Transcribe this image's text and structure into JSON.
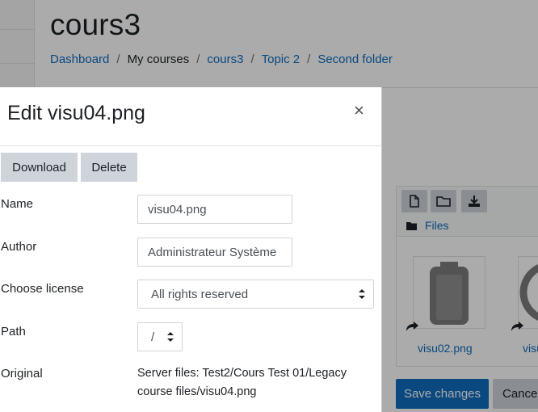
{
  "page": {
    "course_title": "cours3",
    "breadcrumb": {
      "items": [
        "Dashboard",
        "My courses",
        "cours3",
        "Topic 2",
        "Second folder"
      ],
      "separator": "/"
    }
  },
  "filemanager": {
    "path_label": "Files",
    "files": [
      "visu02.png",
      "visu"
    ],
    "toolbar_icons": [
      "add-file-icon",
      "create-folder-icon",
      "download-all-icon"
    ]
  },
  "form_buttons": {
    "save": "Save changes",
    "cancel": "Cancel"
  },
  "dialog": {
    "title": "Edit visu04.png",
    "close": "×",
    "download_label": "Download",
    "delete_label": "Delete",
    "name_label": "Name",
    "name_value": "visu04.png",
    "author_label": "Author",
    "author_value": "Administrateur Système",
    "license_label": "Choose license",
    "license_value": "All rights reserved",
    "path_label": "Path",
    "path_value": "/",
    "original_label": "Original",
    "original_value": "Server files: Test2/Cours Test 01/Legacy course files/visu04.png"
  },
  "colors": {
    "link": "#0f6cbf",
    "primary_button": "#0f6cbf",
    "secondary_button": "#ced4da",
    "overlay": "rgba(0,0,0,0.33)"
  }
}
